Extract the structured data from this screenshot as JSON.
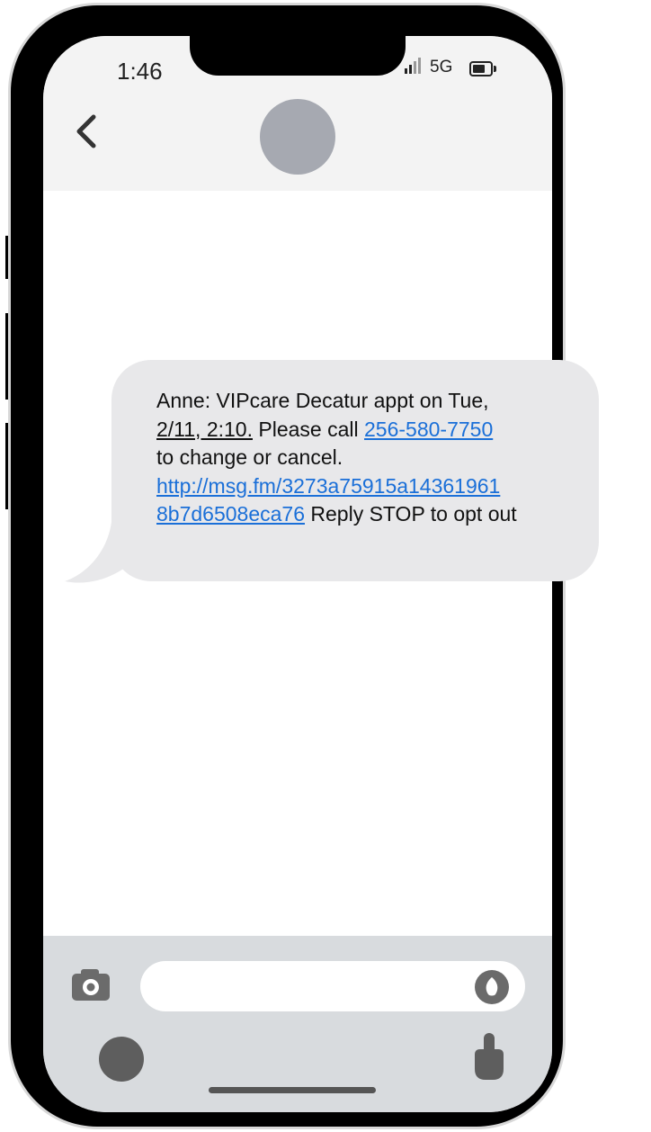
{
  "status_bar": {
    "time": "1:46",
    "network": "5G",
    "battery_icon": "battery-icon",
    "signal_icon": "signal-icon"
  },
  "header": {
    "back_icon": "chevron-left-icon",
    "avatar": "contact-avatar"
  },
  "message": {
    "line1": "Anne: VIPcare Decatur appt on Tue,",
    "date_time": "2/11, 2:10.",
    "text_after_date": " Please call ",
    "phone_link": "256-580-7750",
    "line3": "to change or cancel.",
    "url_part1": "http://msg.fm/3273a75915a14361961",
    "url_part2": "8b7d6508eca76",
    "trailing": " Reply STOP to opt out"
  },
  "compose": {
    "camera_icon": "camera-icon",
    "mic_icon": "microphone-icon",
    "input_value": "",
    "left_button": "circle-button",
    "right_icon": "hand-icon"
  },
  "colors": {
    "link": "#1a6fd8",
    "bubble": "#e8e8ea",
    "header_bg": "#f3f3f3",
    "compose_bg": "#d8dbde",
    "avatar": "#a6a9b1"
  }
}
